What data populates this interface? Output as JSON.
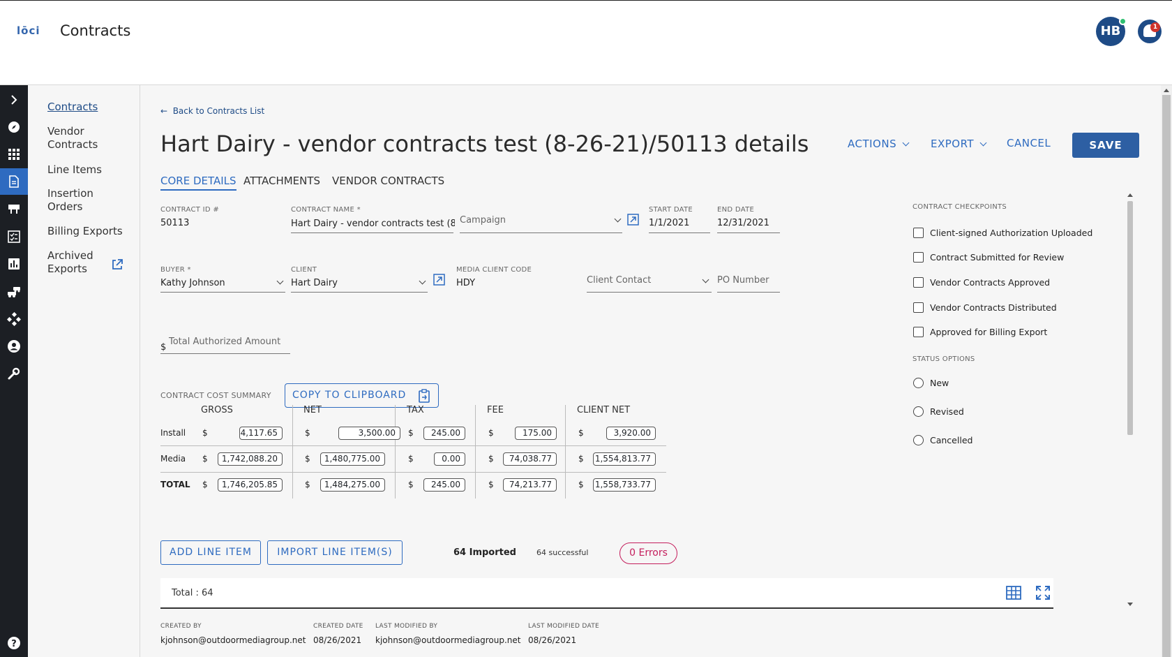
{
  "header": {
    "logo_text": "lōci",
    "app_title": "Contracts",
    "avatar_initials": "HB",
    "notification_count": "1"
  },
  "subnav": {
    "items": [
      "Contracts",
      "Vendor\nContracts",
      "Line Items",
      "Insertion\nOrders",
      "Billing Exports",
      "Archived\nExports"
    ]
  },
  "page": {
    "back_link": "Back to Contracts List",
    "title": "Hart Dairy - vendor contracts test (8-26-21)/50113 details",
    "actions_label": "ACTIONS",
    "export_label": "EXPORT",
    "cancel_label": "CANCEL",
    "save_label": "SAVE"
  },
  "tabs": [
    "CORE DETAILS",
    "ATTACHMENTS",
    "VENDOR CONTRACTS"
  ],
  "fields": {
    "contract_id_label": "CONTRACT ID #",
    "contract_id": "50113",
    "contract_name_label": "CONTRACT NAME *",
    "contract_name": "Hart Dairy - vendor contracts test (8-",
    "campaign_placeholder": "Campaign",
    "start_date_label": "START DATE",
    "start_date": "1/1/2021",
    "end_date_label": "END DATE",
    "end_date": "12/31/2021",
    "buyer_label": "BUYER *",
    "buyer": "Kathy Johnson",
    "client_label": "CLIENT",
    "client": "Hart Dairy",
    "media_client_code_label": "MEDIA CLIENT CODE",
    "media_client_code": "HDY",
    "client_contact_placeholder": "Client Contact",
    "po_number_placeholder": "PO Number",
    "total_authorized_placeholder": "Total Authorized Amount",
    "currency_symbol": "$"
  },
  "cost_summary": {
    "label": "CONTRACT COST SUMMARY",
    "copy_label": "COPY TO CLIPBOARD",
    "columns": [
      "GROSS",
      "NET",
      "TAX",
      "FEE",
      "CLIENT NET"
    ],
    "rows": [
      {
        "label": "Install",
        "values": [
          "4,117.65",
          "3,500.00",
          "245.00",
          "175.00",
          "3,920.00"
        ]
      },
      {
        "label": "Media",
        "values": [
          "1,742,088.20",
          "1,480,775.00",
          "0.00",
          "74,038.77",
          "1,554,813.77"
        ]
      },
      {
        "label": "TOTAL",
        "values": [
          "1,746,205.85",
          "1,484,275.00",
          "245.00",
          "74,213.77",
          "1,558,733.77"
        ]
      }
    ]
  },
  "line_items": {
    "add_label": "ADD LINE ITEM",
    "import_label": "IMPORT LINE ITEM(S)",
    "imported_text": "64 Imported",
    "successful_text": "64 successful",
    "errors_text": "0 Errors",
    "total_text": "Total : 64"
  },
  "meta": {
    "created_by_label": "CREATED BY",
    "created_by": "kjohnson@outdoormediagroup.net",
    "created_date_label": "CREATED DATE",
    "created_date": "08/26/2021",
    "last_modified_by_label": "LAST MODIFIED BY",
    "last_modified_by": "kjohnson@outdoormediagroup.net",
    "last_modified_date_label": "LAST MODIFIED DATE",
    "last_modified_date": "08/26/2021"
  },
  "checkpoints": {
    "label": "CONTRACT CHECKPOINTS",
    "items": [
      "Client-signed Authorization Uploaded",
      "Contract Submitted for Review",
      "Vendor Contracts Approved",
      "Vendor Contracts Distributed",
      "Approved for Billing Export"
    ]
  },
  "status_options": {
    "label": "STATUS OPTIONS",
    "items": [
      "New",
      "Revised",
      "Cancelled"
    ]
  },
  "colors": {
    "primary": "#2e6bc0",
    "save": "#2d5fa3",
    "rail": "#1c1f24",
    "error": "#c41e5c",
    "avatar": "#1e4b86"
  }
}
